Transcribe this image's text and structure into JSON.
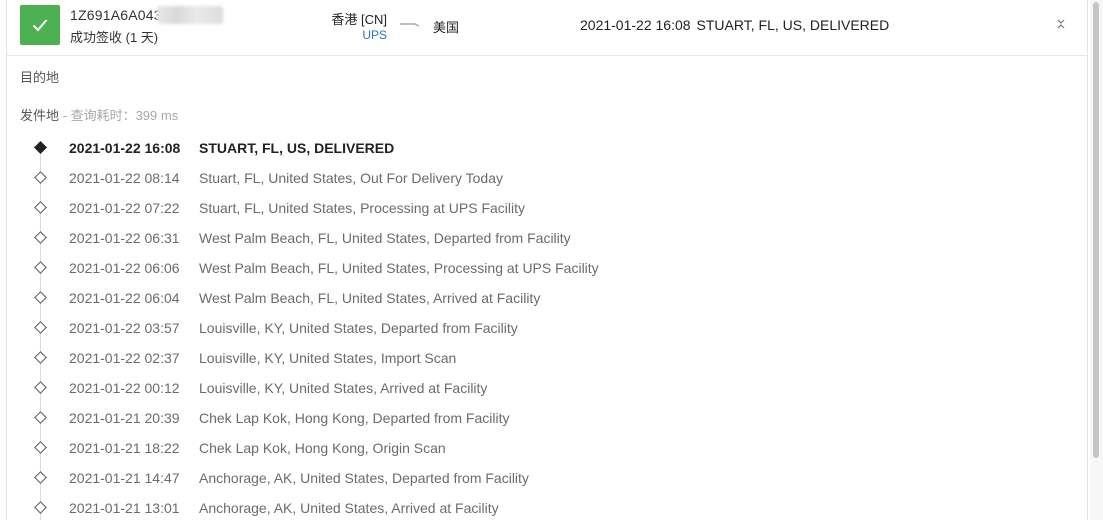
{
  "header": {
    "tracking_number": "1Z691A6A043",
    "status_text": "成功签收 (1 天)",
    "origin": "香港 [CN]",
    "carrier": "UPS",
    "destination": "美国",
    "latest_time": "2021-01-22 16:08",
    "latest_event": "STUART, FL, US, DELIVERED",
    "status_color": "#4caf50",
    "icons": [
      "check-icon",
      "route-arrow-icon",
      "collapse-icon"
    ]
  },
  "sections": {
    "destination_label": "目的地",
    "origin_label": "发件地",
    "origin_meta": " - 查询耗时：399 ms"
  },
  "events": [
    {
      "time": "2021-01-22 16:08",
      "desc": "STUART, FL, US, DELIVERED"
    },
    {
      "time": "2021-01-22 08:14",
      "desc": "Stuart, FL, United States, Out For Delivery Today"
    },
    {
      "time": "2021-01-22 07:22",
      "desc": "Stuart, FL, United States, Processing at UPS Facility"
    },
    {
      "time": "2021-01-22 06:31",
      "desc": "West Palm Beach, FL, United States, Departed from Facility"
    },
    {
      "time": "2021-01-22 06:06",
      "desc": "West Palm Beach, FL, United States, Processing at UPS Facility"
    },
    {
      "time": "2021-01-22 06:04",
      "desc": "West Palm Beach, FL, United States, Arrived at Facility"
    },
    {
      "time": "2021-01-22 03:57",
      "desc": "Louisville, KY, United States, Departed from Facility"
    },
    {
      "time": "2021-01-22 02:37",
      "desc": "Louisville, KY, United States, Import Scan"
    },
    {
      "time": "2021-01-22 00:12",
      "desc": "Louisville, KY, United States, Arrived at Facility"
    },
    {
      "time": "2021-01-21 20:39",
      "desc": "Chek Lap Kok, Hong Kong, Departed from Facility"
    },
    {
      "time": "2021-01-21 18:22",
      "desc": "Chek Lap Kok, Hong Kong, Origin Scan"
    },
    {
      "time": "2021-01-21 14:47",
      "desc": "Anchorage, AK, United States, Departed from Facility"
    },
    {
      "time": "2021-01-21 13:01",
      "desc": "Anchorage, AK, United States, Arrived at Facility"
    }
  ]
}
